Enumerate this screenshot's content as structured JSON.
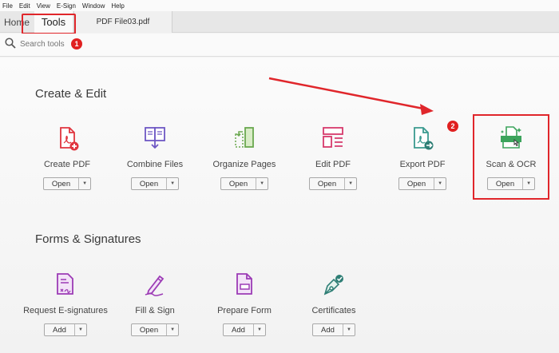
{
  "menubar": {
    "items": [
      "File",
      "Edit",
      "View",
      "E-Sign",
      "Window",
      "Help"
    ]
  },
  "tabs": {
    "home": "Home",
    "tools": "Tools",
    "file": "PDF File03.pdf"
  },
  "search": {
    "placeholder": "Search tools"
  },
  "callouts": {
    "step1": "1",
    "step2": "2"
  },
  "sections": {
    "create_edit": "Create & Edit",
    "forms_signatures": "Forms & Signatures"
  },
  "create_tools": [
    {
      "label": "Create PDF",
      "button": "Open",
      "icon": "create-pdf-icon"
    },
    {
      "label": "Combine Files",
      "button": "Open",
      "icon": "combine-files-icon"
    },
    {
      "label": "Organize Pages",
      "button": "Open",
      "icon": "organize-pages-icon"
    },
    {
      "label": "Edit PDF",
      "button": "Open",
      "icon": "edit-pdf-icon"
    },
    {
      "label": "Export PDF",
      "button": "Open",
      "icon": "export-pdf-icon"
    },
    {
      "label": "Scan & OCR",
      "button": "Open",
      "icon": "scan-ocr-icon"
    }
  ],
  "forms_tools": [
    {
      "label": "Request E-signatures",
      "button": "Add",
      "icon": "request-esignatures-icon"
    },
    {
      "label": "Fill & Sign",
      "button": "Open",
      "icon": "fill-sign-icon"
    },
    {
      "label": "Prepare Form",
      "button": "Add",
      "icon": "prepare-form-icon"
    },
    {
      "label": "Certificates",
      "button": "Add",
      "icon": "certificates-icon"
    }
  ],
  "colors": {
    "highlight": "#e0262b",
    "create_pdf": "#e0343e",
    "combine": "#6e58c4",
    "organize": "#6aa84f",
    "edit": "#d63a6c",
    "export": "#3a9a8f",
    "scan": "#3ca45c",
    "forms": "#9c3bb5"
  }
}
